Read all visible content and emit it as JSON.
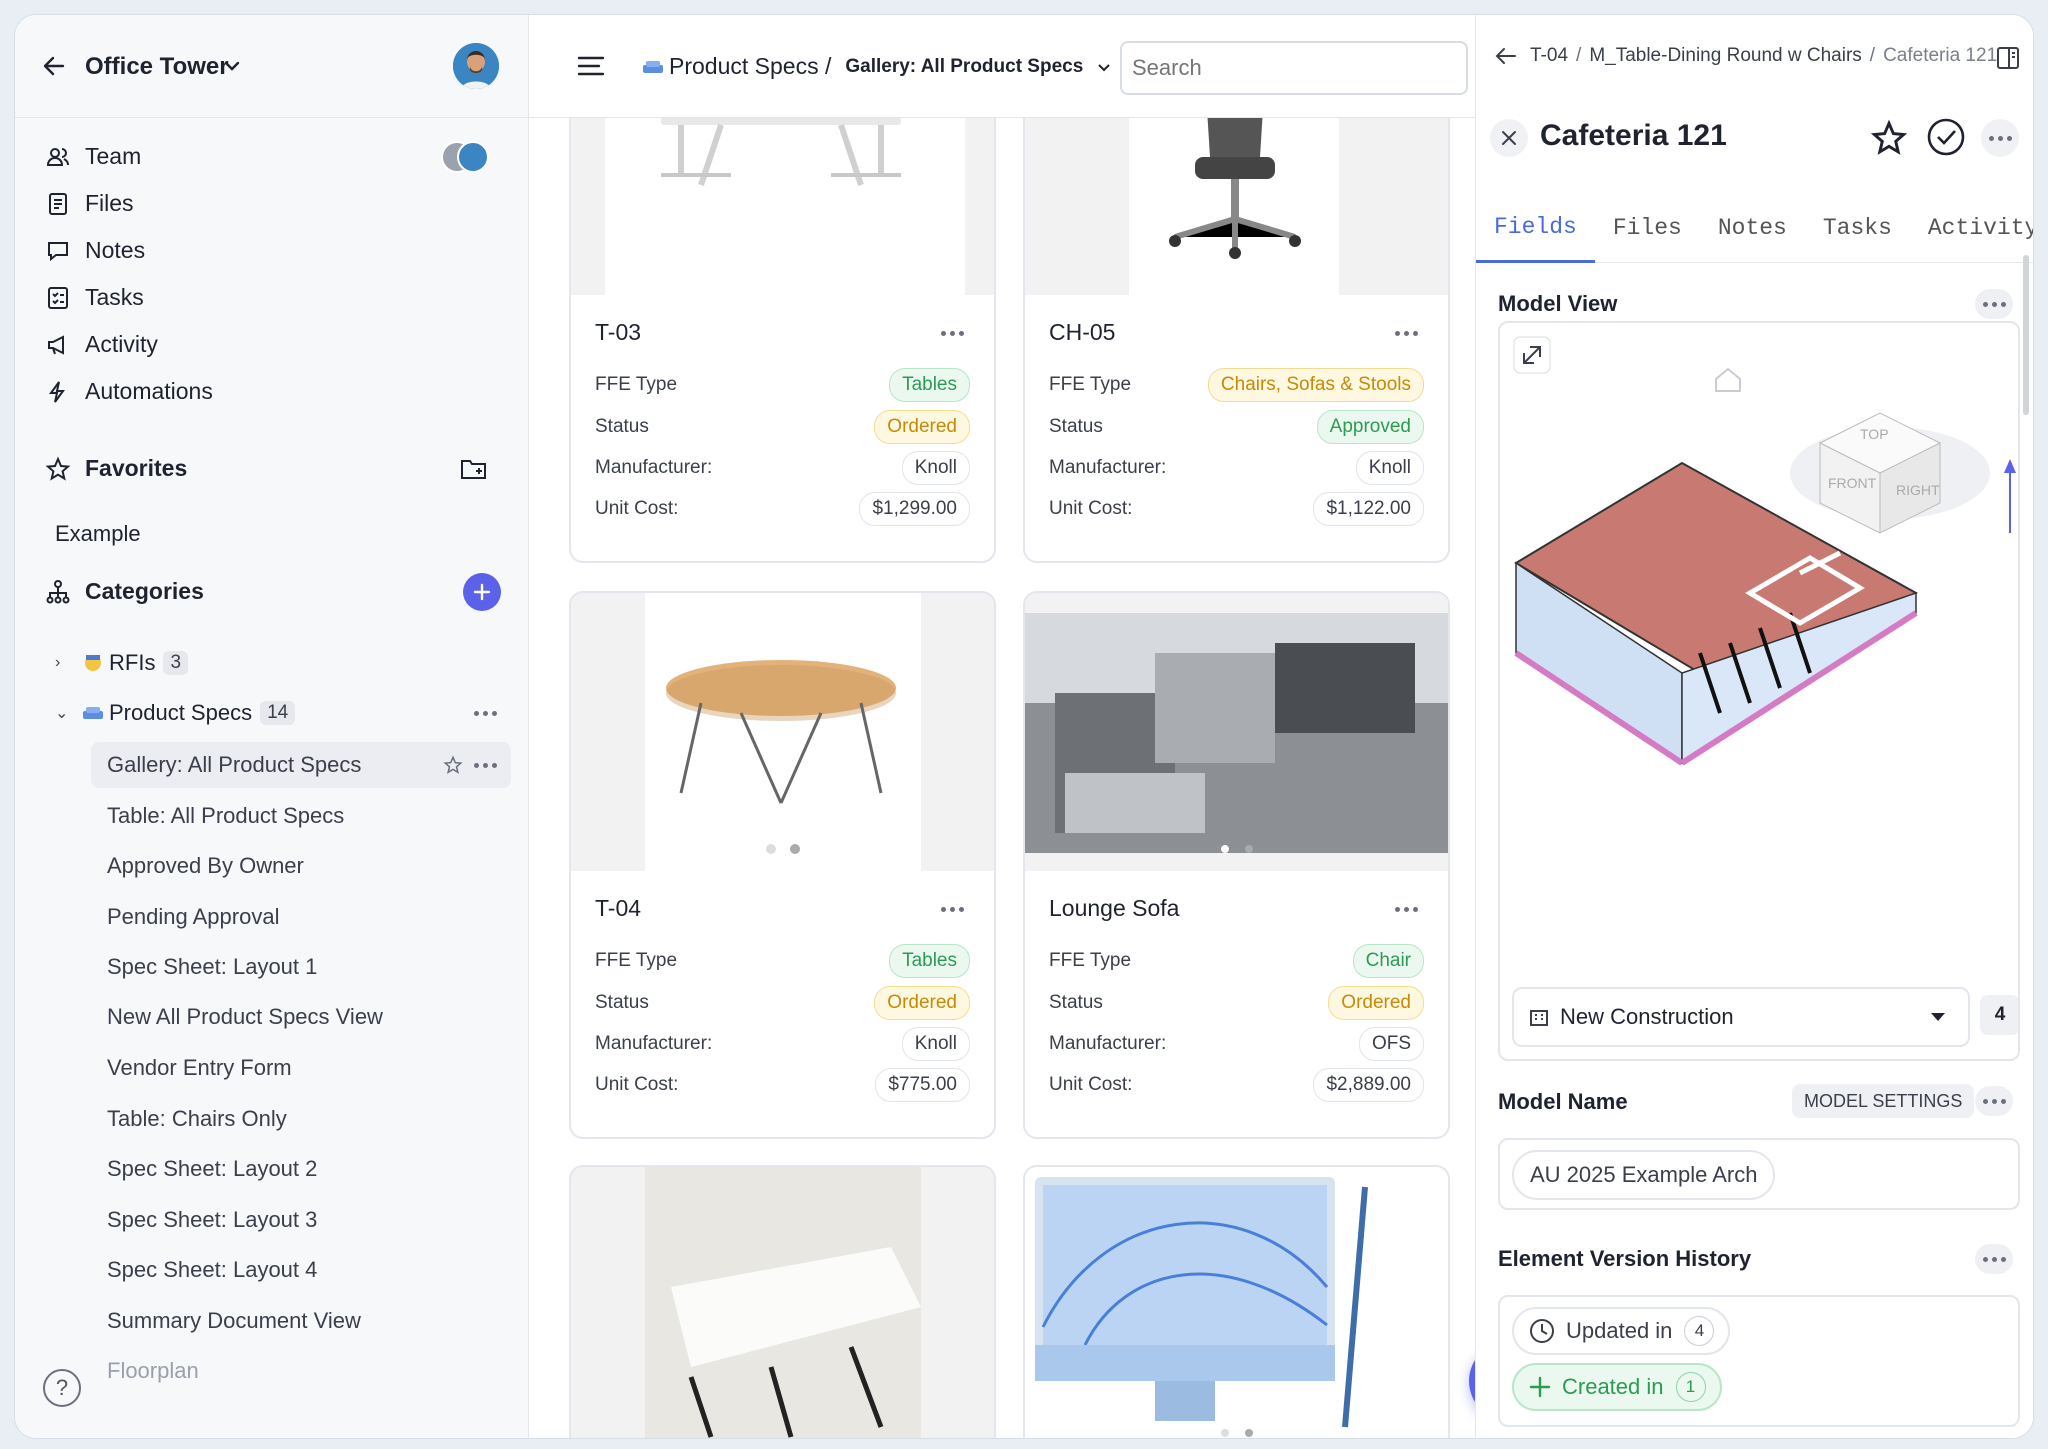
{
  "sidebar": {
    "project_title": "Office Tower",
    "nav": [
      {
        "label": "Team",
        "icon": "team-icon"
      },
      {
        "label": "Files",
        "icon": "files-icon"
      },
      {
        "label": "Notes",
        "icon": "notes-icon"
      },
      {
        "label": "Tasks",
        "icon": "tasks-icon"
      },
      {
        "label": "Activity",
        "icon": "activity-icon"
      },
      {
        "label": "Automations",
        "icon": "automations-icon"
      }
    ],
    "favorites_label": "Favorites",
    "favorites_items": [
      "Example"
    ],
    "categories_label": "Categories",
    "tree": [
      {
        "label": "RFIs",
        "count": "3"
      },
      {
        "label": "Product Specs",
        "count": "14"
      }
    ],
    "views": [
      "Gallery: All Product Specs",
      "Table: All Product Specs",
      "Approved By Owner",
      "Pending Approval",
      "Spec Sheet: Layout 1",
      "New All Product Specs View",
      "Vendor Entry Form",
      "Table: Chairs Only",
      "Spec Sheet: Layout 2",
      "Spec Sheet: Layout 3",
      "Spec Sheet: Layout 4",
      "Summary Document View",
      "Floorplan"
    ],
    "help": "?"
  },
  "topbar": {
    "crumb_category": "Product Specs /",
    "crumb_view": "Gallery: All Product Specs",
    "search_placeholder": "Search"
  },
  "field_labels": {
    "type": "FFE Type",
    "status": "Status",
    "manufacturer": "Manufacturer:",
    "cost": "Unit Cost:"
  },
  "cards": [
    {
      "title": "T-03",
      "type": "Tables",
      "status": "Ordered",
      "manufacturer": "Knoll",
      "cost": "$1,299.00"
    },
    {
      "title": "CH-05",
      "type": "Chairs, Sofas & Stools",
      "status": "Approved",
      "manufacturer": "Knoll",
      "cost": "$1,122.00"
    },
    {
      "title": "T-04",
      "type": "Tables",
      "status": "Ordered",
      "manufacturer": "Knoll",
      "cost": "$775.00"
    },
    {
      "title": "Lounge Sofa",
      "type": "Chair",
      "status": "Ordered",
      "manufacturer": "OFS",
      "cost": "$2,889.00"
    }
  ],
  "panel": {
    "crumb": [
      "T-04",
      "M_Table-Dining Round w Chairs",
      "Cafeteria 121"
    ],
    "title": "Cafeteria 121",
    "tabs": [
      "Fields",
      "Files",
      "Notes",
      "Tasks",
      "Activity"
    ],
    "model_view_label": "Model View",
    "phase": "New Construction",
    "phase_count": "4",
    "model_name_label": "Model Name",
    "model_settings_label": "MODEL SETTINGS",
    "model_name_value": "AU 2025 Example Arch",
    "history_label": "Element Version History",
    "updated_label": "Updated in",
    "updated_count": "4",
    "created_label": "Created in",
    "created_count": "1",
    "cube_labels": {
      "top": "TOP",
      "front": "FRONT",
      "right": "RIGHT"
    }
  }
}
